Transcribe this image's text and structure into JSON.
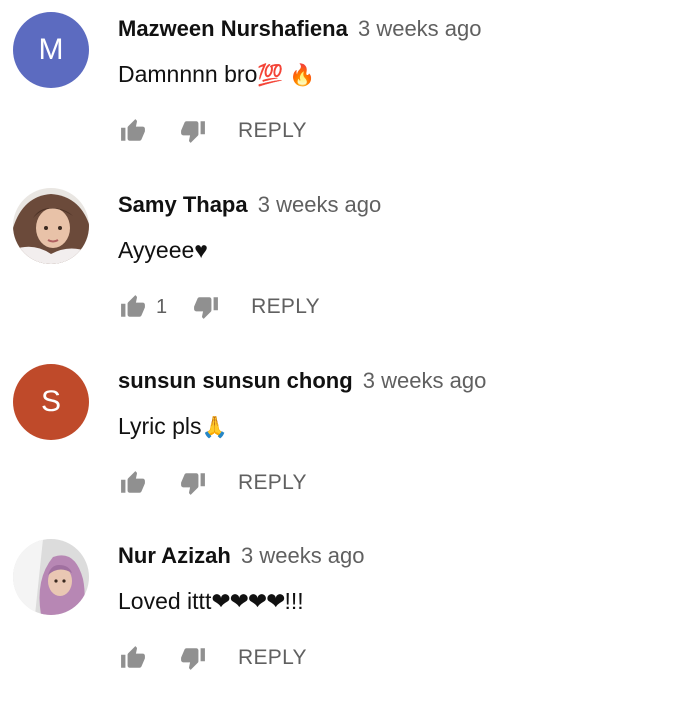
{
  "comments": [
    {
      "author": "Mazween Nurshafiena",
      "time": "3 weeks ago",
      "text": "Damnnnn bro",
      "emoji": "💯 🔥",
      "avatar_letter": "M",
      "avatar_color": "#5c6bc0",
      "likes": "",
      "reply": "REPLY"
    },
    {
      "author": "Samy Thapa",
      "time": "3 weeks ago",
      "text": "Ayyeee♥",
      "avatar_letter": "",
      "likes": "1",
      "reply": "REPLY"
    },
    {
      "author": "sunsun sunsun chong",
      "time": "3 weeks ago",
      "text": "Lyric pls",
      "emoji": "🙏",
      "avatar_letter": "S",
      "avatar_color": "#bf4a2a",
      "likes": "",
      "reply": "REPLY"
    },
    {
      "author": "Nur Azizah",
      "time": "3 weeks ago",
      "text": "Loved ittt",
      "hearts": "❤❤❤❤",
      "suffix": "!!!",
      "avatar_letter": "",
      "likes": "",
      "reply": "REPLY"
    }
  ]
}
